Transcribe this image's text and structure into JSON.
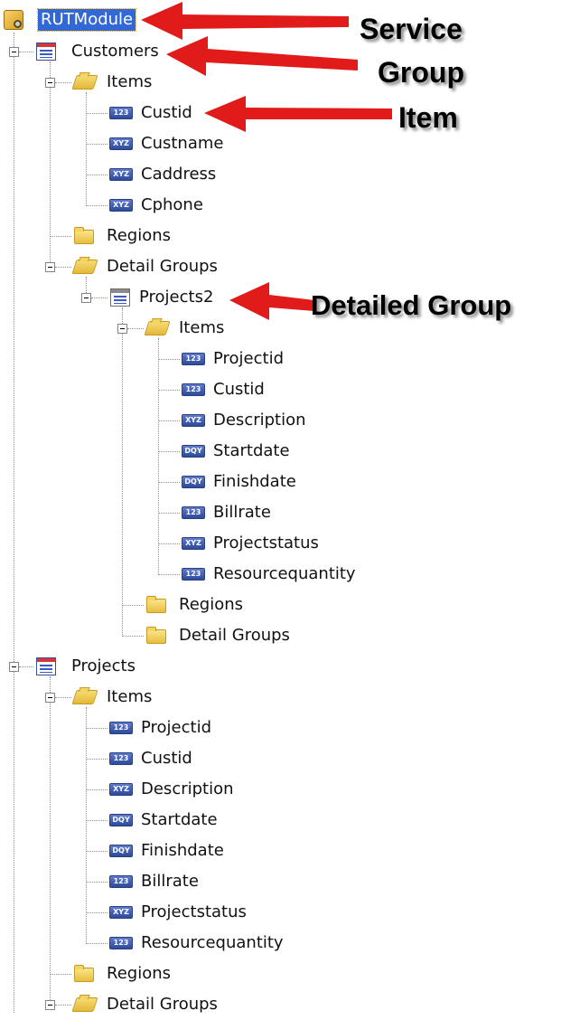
{
  "colors": {
    "selection": "#3167d6",
    "arrow": "#e11a1a",
    "badge": "#3a56b0",
    "folder": "#f2cf57"
  },
  "tree": {
    "service": {
      "label": "RUTModule",
      "icon": "service-icon"
    },
    "customers": {
      "label": "Customers",
      "icon": "group-icon",
      "items_folder": "Items",
      "items": [
        {
          "label": "Custid",
          "type": "123"
        },
        {
          "label": "Custname",
          "type": "XYZ"
        },
        {
          "label": "Caddress",
          "type": "XYZ"
        },
        {
          "label": "Cphone",
          "type": "XYZ"
        }
      ],
      "regions": "Regions",
      "detail_groups": "Detail Groups",
      "detail": {
        "label": "Projects2",
        "icon": "detail-group-icon",
        "items_folder": "Items",
        "items": [
          {
            "label": "Projectid",
            "type": "123"
          },
          {
            "label": "Custid",
            "type": "123"
          },
          {
            "label": "Description",
            "type": "XYZ"
          },
          {
            "label": "Startdate",
            "type": "DQY"
          },
          {
            "label": "Finishdate",
            "type": "DQY"
          },
          {
            "label": "Billrate",
            "type": "123"
          },
          {
            "label": "Projectstatus",
            "type": "XYZ"
          },
          {
            "label": "Resourcequantity",
            "type": "123"
          }
        ],
        "regions": "Regions",
        "detail_groups": "Detail Groups"
      }
    },
    "projects": {
      "label": "Projects",
      "icon": "group-icon",
      "items_folder": "Items",
      "items": [
        {
          "label": "Projectid",
          "type": "123"
        },
        {
          "label": "Custid",
          "type": "123"
        },
        {
          "label": "Description",
          "type": "XYZ"
        },
        {
          "label": "Startdate",
          "type": "DQY"
        },
        {
          "label": "Finishdate",
          "type": "DQY"
        },
        {
          "label": "Billrate",
          "type": "123"
        },
        {
          "label": "Projectstatus",
          "type": "XYZ"
        },
        {
          "label": "Resourcequantity",
          "type": "123"
        }
      ],
      "regions": "Regions",
      "detail_groups": "Detail Groups"
    }
  },
  "annotations": {
    "service": "Service",
    "group": "Group",
    "item": "Item",
    "detailed_group": "Detailed Group"
  }
}
